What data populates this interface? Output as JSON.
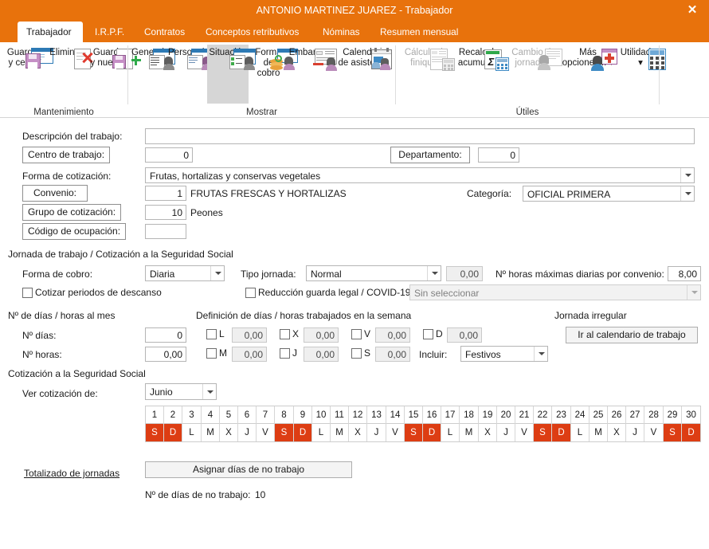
{
  "window": {
    "title": "ANTONIO MARTINEZ JUAREZ - Trabajador",
    "close_label": "✕",
    "accent_color": "#e8720c",
    "weekend_color": "#dd3d13"
  },
  "tabs": [
    {
      "label": "Trabajador",
      "active": true
    },
    {
      "label": "I.R.P.F.",
      "active": false
    },
    {
      "label": "Contratos",
      "active": false
    },
    {
      "label": "Conceptos retributivos",
      "active": false
    },
    {
      "label": "Nóminas",
      "active": false
    },
    {
      "label": "Resumen mensual",
      "active": false
    }
  ],
  "ribbon": {
    "groups": [
      {
        "label": "Mantenimiento"
      },
      {
        "label": "Mostrar"
      },
      {
        "label": "Útiles"
      }
    ],
    "buttons": [
      {
        "line1": "Guardar",
        "line2": "y cerrar",
        "icon": "save-close-icon",
        "state": "normal"
      },
      {
        "line1": "Eliminar",
        "line2": "",
        "icon": "delete-icon",
        "state": "normal"
      },
      {
        "line1": "Guardar",
        "line2": "y nuevo ▾",
        "icon": "save-new-icon",
        "state": "normal"
      },
      {
        "line1": "General",
        "line2": "",
        "icon": "general-icon",
        "state": "normal"
      },
      {
        "line1": "Personal",
        "line2": "",
        "icon": "personal-icon",
        "state": "normal"
      },
      {
        "line1": "Situación",
        "line2": "",
        "icon": "situacion-icon",
        "state": "selected"
      },
      {
        "line1": "Forma",
        "line2": "de cobro",
        "icon": "forma-cobro-icon",
        "state": "normal"
      },
      {
        "line1": "Embargos",
        "line2": "",
        "icon": "embargos-icon",
        "state": "normal"
      },
      {
        "line1": "Calendario",
        "line2": "de asistencia",
        "icon": "calendario-asistencia-icon",
        "state": "normal"
      },
      {
        "line1": "Cálculo de",
        "line2": "finiquito",
        "icon": "calculo-finiquito-icon",
        "state": "disabled"
      },
      {
        "line1": "Recalcular",
        "line2": "acumulado",
        "icon": "recalcular-acumulado-icon",
        "state": "normal"
      },
      {
        "line1": "Cambio de",
        "line2": "jornada ▾",
        "icon": "cambio-jornada-icon",
        "state": "disabled"
      },
      {
        "line1": "Más",
        "line2": "opciones... ▾",
        "icon": "mas-opciones-icon",
        "state": "normal"
      },
      {
        "line1": "Utilidades",
        "line2": "▾",
        "icon": "utilidades-icon",
        "state": "normal"
      }
    ]
  },
  "form": {
    "descripcion_label": "Descripción del trabajo:",
    "descripcion_value": "",
    "centro_trabajo_label": "Centro de trabajo:",
    "centro_trabajo_value": "0",
    "departamento_label": "Departamento:",
    "departamento_value": "0",
    "forma_cotizacion_label": "Forma de cotización:",
    "forma_cotizacion_value": "Frutas, hortalizas y conservas vegetales",
    "convenio_label": "Convenio:",
    "convenio_code": "1",
    "convenio_desc": "FRUTAS FRESCAS Y HORTALIZAS",
    "categoria_label": "Categoría:",
    "categoria_value": "OFICIAL PRIMERA",
    "grupo_cotizacion_label": "Grupo de cotización:",
    "grupo_cotizacion_code": "10",
    "grupo_cotizacion_desc": "Peones",
    "codigo_ocupacion_label": "Código de ocupación:",
    "codigo_ocupacion_value": ""
  },
  "jornada": {
    "section_label": "Jornada de trabajo / Cotización a la Seguridad Social",
    "forma_cobro_label": "Forma de cobro:",
    "forma_cobro_value": "Diaria",
    "tipo_jornada_label": "Tipo jornada:",
    "tipo_jornada_value": "Normal",
    "tipo_jornada_num": "0,00",
    "horas_max_label": "Nº horas máximas diarias por convenio:",
    "horas_max_value": "8,00",
    "cotizar_descanso_label": "Cotizar periodos de descanso",
    "reduccion_label": "Reducción guarda legal / COVID-19",
    "reduccion_value": "Sin seleccionar"
  },
  "dias_mes": {
    "section_label": "Nº de días / horas al mes",
    "dias_label": "Nº días:",
    "dias_value": "0",
    "horas_label": "Nº horas:",
    "horas_value": "0,00"
  },
  "semana": {
    "section_label": "Definición de días / horas trabajados en la semana",
    "days": [
      {
        "code": "L",
        "value": "0,00",
        "checked": false
      },
      {
        "code": "M",
        "value": "0,00",
        "checked": false
      },
      {
        "code": "X",
        "value": "0,00",
        "checked": false
      },
      {
        "code": "J",
        "value": "0,00",
        "checked": false
      },
      {
        "code": "V",
        "value": "0,00",
        "checked": false
      },
      {
        "code": "S",
        "value": "0,00",
        "checked": false
      },
      {
        "code": "D",
        "value": "0,00",
        "checked": false
      }
    ],
    "incluir_label": "Incluir:",
    "incluir_value": "Festivos"
  },
  "jornada_irregular": {
    "section_label": "Jornada irregular",
    "button_label": "Ir al calendario de trabajo"
  },
  "cotizacion": {
    "section_label": "Cotización a la Seguridad Social",
    "ver_cotizacion_label": "Ver cotización de:",
    "ver_cotizacion_value": "Junio"
  },
  "calendar": {
    "days": [
      1,
      2,
      3,
      4,
      5,
      6,
      7,
      8,
      9,
      10,
      11,
      12,
      13,
      14,
      15,
      16,
      17,
      18,
      19,
      20,
      21,
      22,
      23,
      24,
      25,
      26,
      27,
      28,
      29,
      30
    ],
    "letters": [
      "S",
      "D",
      "L",
      "M",
      "X",
      "J",
      "V",
      "S",
      "D",
      "L",
      "M",
      "X",
      "J",
      "V",
      "S",
      "D",
      "L",
      "M",
      "X",
      "J",
      "V",
      "S",
      "D",
      "L",
      "M",
      "X",
      "J",
      "V",
      "S",
      "D"
    ],
    "weekend_flags": [
      true,
      true,
      false,
      false,
      false,
      false,
      false,
      true,
      true,
      false,
      false,
      false,
      false,
      false,
      true,
      true,
      false,
      false,
      false,
      false,
      false,
      true,
      true,
      false,
      false,
      false,
      false,
      false,
      true,
      true
    ]
  },
  "footer": {
    "totalizado_link": "Totalizado de jornadas",
    "asignar_button": "Asignar días de no trabajo",
    "no_trabajo_label": "Nº de días de no trabajo:",
    "no_trabajo_value": "10"
  }
}
